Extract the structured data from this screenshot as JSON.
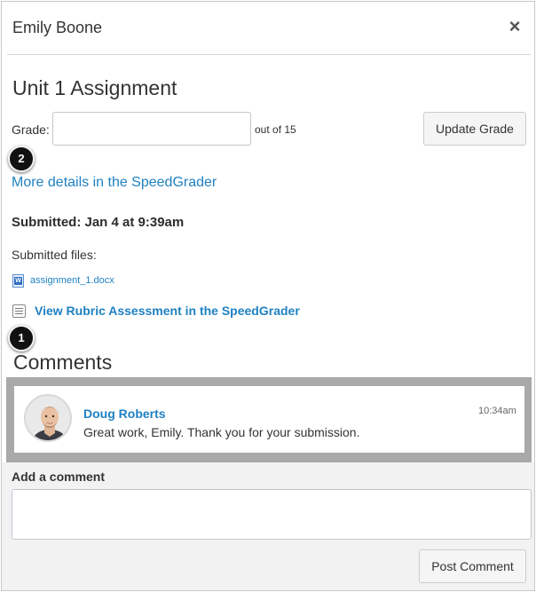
{
  "header": {
    "title": "Emily Boone",
    "close_glyph": "×",
    "close_icon": "close-icon"
  },
  "assignment": {
    "title": "Unit 1 Assignment",
    "grade_label": "Grade:",
    "grade_value": "",
    "out_of": "out of 15",
    "update_button": "Update Grade"
  },
  "badges": {
    "speedgrader_details": "2",
    "rubric": "1"
  },
  "speedgrader_link": "More details in the SpeedGrader",
  "submission": {
    "submitted": "Submitted: Jan 4 at 9:39am",
    "files_label": "Submitted files:",
    "files": [
      {
        "name": "assignment_1.docx",
        "icon": "word-document-icon"
      }
    ],
    "rubric_link": "View Rubric Assessment in the SpeedGrader",
    "rubric_icon": "rubric-list-icon"
  },
  "comments": {
    "heading": "Comments",
    "items": [
      {
        "author": "Doug Roberts",
        "text": "Great work, Emily. Thank you for your submission.",
        "time": "10:34am",
        "avatar": "user-avatar"
      }
    ]
  },
  "add_comment": {
    "label": "Add a comment",
    "value": "",
    "post_button": "Post Comment"
  },
  "colors": {
    "link": "#1f81c2",
    "badge": "#111111",
    "comments_frame": "#a9a9a9",
    "add_panel": "#f2f2f2"
  }
}
